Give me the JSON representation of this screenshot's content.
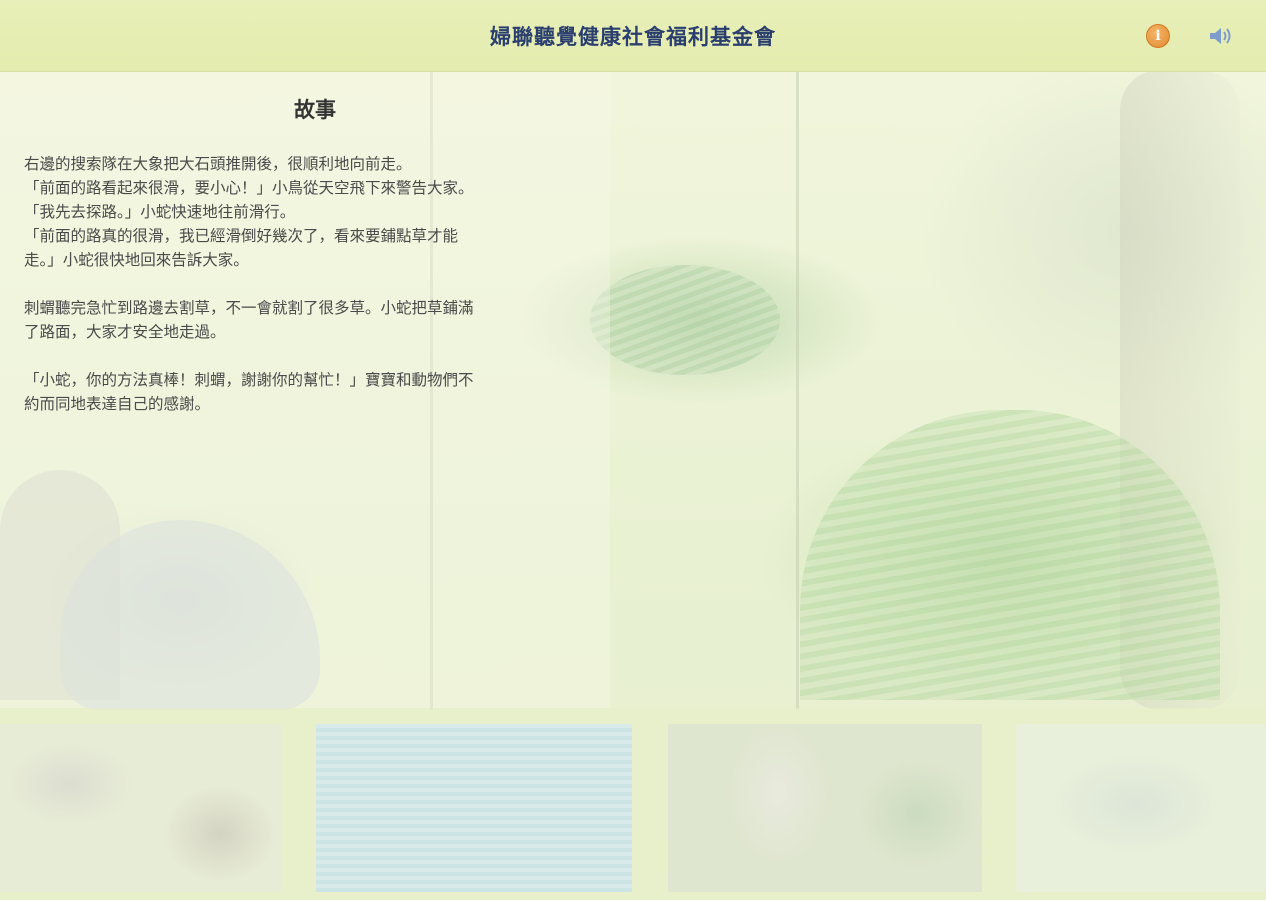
{
  "header": {
    "title": "婦聯聽覺健康社會福利基金會",
    "info_icon": "info-icon",
    "sound_icon": "speaker-icon"
  },
  "story": {
    "title": "故事",
    "paragraphs": [
      [
        "右邊的搜索隊在大象把大石頭推開後，很順利地向前走。",
        "「前面的路看起來很滑，要小心！」小鳥從天空飛下來警告大家。",
        "「我先去探路。」小蛇快速地往前滑行。",
        "「前面的路真的很滑，我已經滑倒好幾次了，看來要鋪點草才能",
        "走。」小蛇很快地回來告訴大家。"
      ],
      [
        "刺蝟聽完急忙到路邊去割草，不一會就割了很多草。小蛇把草鋪滿",
        "了路面，大家才安全地走過。"
      ],
      [
        "「小蛇，你的方法真棒！刺蝟，謝謝你的幫忙！」寶寶和動物們不",
        "約而同地表達自己的感謝。"
      ]
    ]
  },
  "colors": {
    "header_bg": "#e6edb3",
    "title_color": "#2b3f6f",
    "info_orange": "#e88f2f",
    "speaker_blue": "#6f8fc4"
  }
}
